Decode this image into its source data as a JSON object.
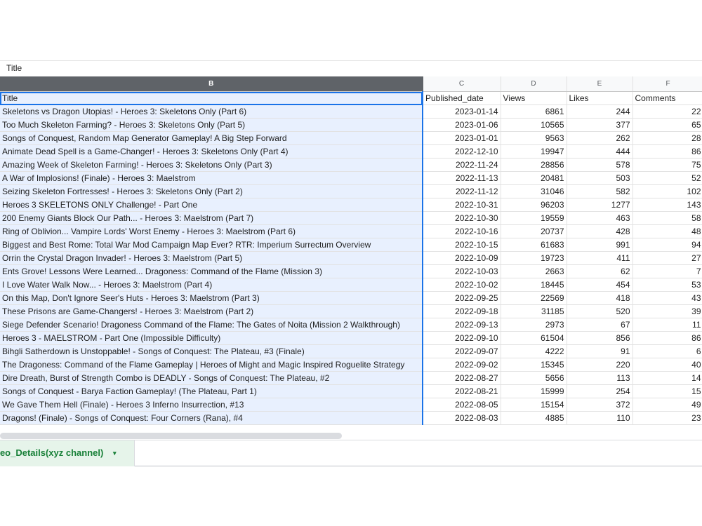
{
  "formula_bar": {
    "value": "Title"
  },
  "column_letters": [
    "B",
    "C",
    "D",
    "E",
    "F"
  ],
  "header_row": [
    "Title",
    "Published_date",
    "Views",
    "Likes",
    "Comments"
  ],
  "rows": [
    [
      "Skeletons vs Dragon Utopias! - Heroes 3: Skeletons Only (Part 6)",
      "2023-01-14",
      "6861",
      "244",
      "22"
    ],
    [
      "Too Much Skeleton Farming? - Heroes 3: Skeletons Only (Part 5)",
      "2023-01-06",
      "10565",
      "377",
      "65"
    ],
    [
      "Songs of Conquest, Random Map Generator Gameplay! A Big Step Forward",
      "2023-01-01",
      "9563",
      "262",
      "28"
    ],
    [
      "Animate Dead Spell is a Game-Changer! - Heroes 3: Skeletons Only (Part 4)",
      "2022-12-10",
      "19947",
      "444",
      "86"
    ],
    [
      "Amazing Week of Skeleton Farming! - Heroes 3: Skeletons Only (Part 3)",
      "2022-11-24",
      "28856",
      "578",
      "75"
    ],
    [
      "A War of Implosions! (Finale) - Heroes 3: Maelstrom",
      "2022-11-13",
      "20481",
      "503",
      "52"
    ],
    [
      "Seizing Skeleton Fortresses! - Heroes 3: Skeletons Only (Part 2)",
      "2022-11-12",
      "31046",
      "582",
      "102"
    ],
    [
      "Heroes 3 SKELETONS ONLY Challenge! - Part One",
      "2022-10-31",
      "96203",
      "1277",
      "143"
    ],
    [
      "200 Enemy Giants Block Our Path... - Heroes 3: Maelstrom (Part 7)",
      "2022-10-30",
      "19559",
      "463",
      "58"
    ],
    [
      "Ring of Oblivion... Vampire Lords' Worst Enemy - Heroes 3: Maelstrom (Part 6)",
      "2022-10-16",
      "20737",
      "428",
      "48"
    ],
    [
      "Biggest and Best Rome: Total War Mod Campaign Map Ever? RTR: Imperium Surrectum Overview",
      "2022-10-15",
      "61683",
      "991",
      "94"
    ],
    [
      "Orrin the Crystal Dragon Invader! - Heroes 3: Maelstrom (Part 5)",
      "2022-10-09",
      "19723",
      "411",
      "27"
    ],
    [
      "Ents Grove! Lessons Were Learned... Dragoness: Command of the Flame (Mission 3)",
      "2022-10-03",
      "2663",
      "62",
      "7"
    ],
    [
      "I Love Water Walk Now... - Heroes 3: Maelstrom (Part 4)",
      "2022-10-02",
      "18445",
      "454",
      "53"
    ],
    [
      "On this Map, Don't Ignore Seer's Huts - Heroes 3: Maelstrom (Part 3)",
      "2022-09-25",
      "22569",
      "418",
      "43"
    ],
    [
      "These Prisons are Game-Changers! - Heroes 3: Maelstrom (Part 2)",
      "2022-09-18",
      "31185",
      "520",
      "39"
    ],
    [
      "Siege Defender Scenario! Dragoness Command of the Flame: The Gates of Noita (Mission 2 Walkthrough)",
      "2022-09-13",
      "2973",
      "67",
      "11"
    ],
    [
      "Heroes 3 - MAELSTROM - Part One (Impossible Difficulty)",
      "2022-09-10",
      "61504",
      "856",
      "86"
    ],
    [
      "Bihgli Satherdown is Unstoppable! - Songs of Conquest: The Plateau, #3 (Finale)",
      "2022-09-07",
      "4222",
      "91",
      "6"
    ],
    [
      "The Dragoness: Command of the Flame Gameplay | Heroes of Might and Magic Inspired Roguelite Strategy",
      "2022-09-02",
      "15345",
      "220",
      "40"
    ],
    [
      "Dire Dreath, Burst of Strength Combo is DEADLY - Songs of Conquest: The Plateau, #2",
      "2022-08-27",
      "5656",
      "113",
      "14"
    ],
    [
      "Songs of Conquest - Barya Faction Gameplay! (The Plateau, Part 1)",
      "2022-08-21",
      "15999",
      "254",
      "15"
    ],
    [
      "We Gave Them Hell (Finale) - Heroes 3 Inferno Insurrection, #13",
      "2022-08-05",
      "15154",
      "372",
      "49"
    ],
    [
      "Dragons! (Finale) - Songs of Conquest: Four Corners (Rana), #4",
      "2022-08-03",
      "4885",
      "110",
      "23"
    ]
  ],
  "sheet_tab": {
    "label": "deo_Details(xyz channel)",
    "caret": "▾"
  },
  "colors": {
    "selected_column_header": "#5f6368",
    "selection_fill": "#e8f0fe",
    "selection_border": "#1a73e8",
    "active_tab_text": "#188038",
    "active_tab_fill": "#e6f4ea"
  }
}
